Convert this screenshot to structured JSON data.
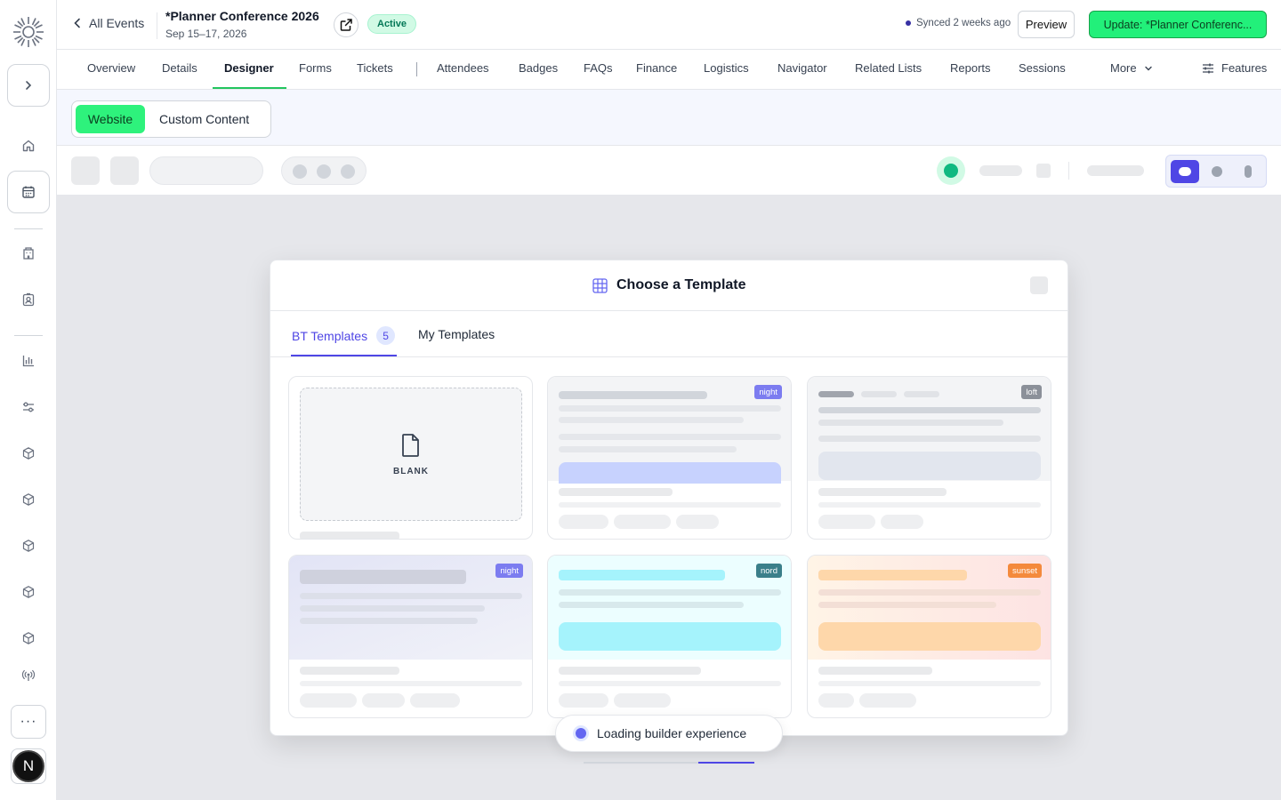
{
  "header": {
    "back_label": "All Events",
    "event_title": "*Planner Conference 2026",
    "event_dates": "Sep 15–17, 2026",
    "status_badge": "Active",
    "synced_text": "Synced 2 weeks ago",
    "preview_label": "Preview",
    "update_label": "Update: *Planner Conferenc..."
  },
  "nav": {
    "tabs": [
      "Overview",
      "Details",
      "Designer",
      "Forms",
      "Tickets",
      "Attendees",
      "Badges",
      "FAQs",
      "Finance",
      "Logistics",
      "Navigator",
      "Related Lists",
      "Reports",
      "Sessions"
    ],
    "active_tab": "Designer",
    "more_label": "More",
    "features_label": "Features"
  },
  "subbar": {
    "website_label": "Website",
    "custom_label": "Custom Content"
  },
  "modal": {
    "title": "Choose a Template",
    "tab_bt": "BT Templates",
    "tab_bt_count": "5",
    "tab_my": "My Templates",
    "blank_label": "BLANK",
    "tags": [
      "night",
      "loft",
      "night",
      "nord",
      "sunset"
    ]
  },
  "toast": {
    "text": "Loading builder experience",
    "progress": 0.33
  },
  "user": {
    "avatar_initial": "N"
  },
  "colors": {
    "accent_green": "#22f07a",
    "brand_indigo": "#4f46e5",
    "tag_night": "#7c7cf0",
    "tag_loft": "#8b9099",
    "tag_nord": "#3b7f8a",
    "tag_sunset": "#f48a3c"
  }
}
